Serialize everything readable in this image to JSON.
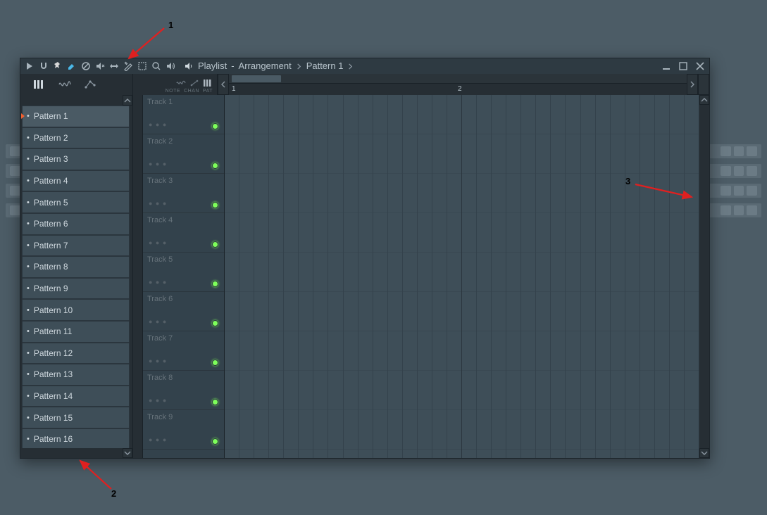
{
  "titlebar": {
    "label_playlist": "Playlist",
    "label_arrangement": "Arrangement",
    "label_pattern": "Pattern 1"
  },
  "subbar": {
    "labels": {
      "note": "NOTE",
      "chan": "CHAN",
      "pat": "PAT"
    }
  },
  "timeline": {
    "bars": [
      "1",
      "2"
    ]
  },
  "patterns": [
    {
      "label": "Pattern 1",
      "selected": true
    },
    {
      "label": "Pattern 2"
    },
    {
      "label": "Pattern 3"
    },
    {
      "label": "Pattern 4"
    },
    {
      "label": "Pattern 5"
    },
    {
      "label": "Pattern 6"
    },
    {
      "label": "Pattern 7"
    },
    {
      "label": "Pattern 8"
    },
    {
      "label": "Pattern 9"
    },
    {
      "label": "Pattern 10"
    },
    {
      "label": "Pattern 11"
    },
    {
      "label": "Pattern 12"
    },
    {
      "label": "Pattern 13"
    },
    {
      "label": "Pattern 14"
    },
    {
      "label": "Pattern 15"
    },
    {
      "label": "Pattern 16"
    }
  ],
  "tracks": [
    {
      "name": "Track 1"
    },
    {
      "name": "Track 2"
    },
    {
      "name": "Track 3"
    },
    {
      "name": "Track 4"
    },
    {
      "name": "Track 5"
    },
    {
      "name": "Track 6"
    },
    {
      "name": "Track 7"
    },
    {
      "name": "Track 8"
    },
    {
      "name": "Track 9"
    }
  ],
  "annotations": {
    "a1": "1",
    "a2": "2",
    "a3": "3"
  }
}
